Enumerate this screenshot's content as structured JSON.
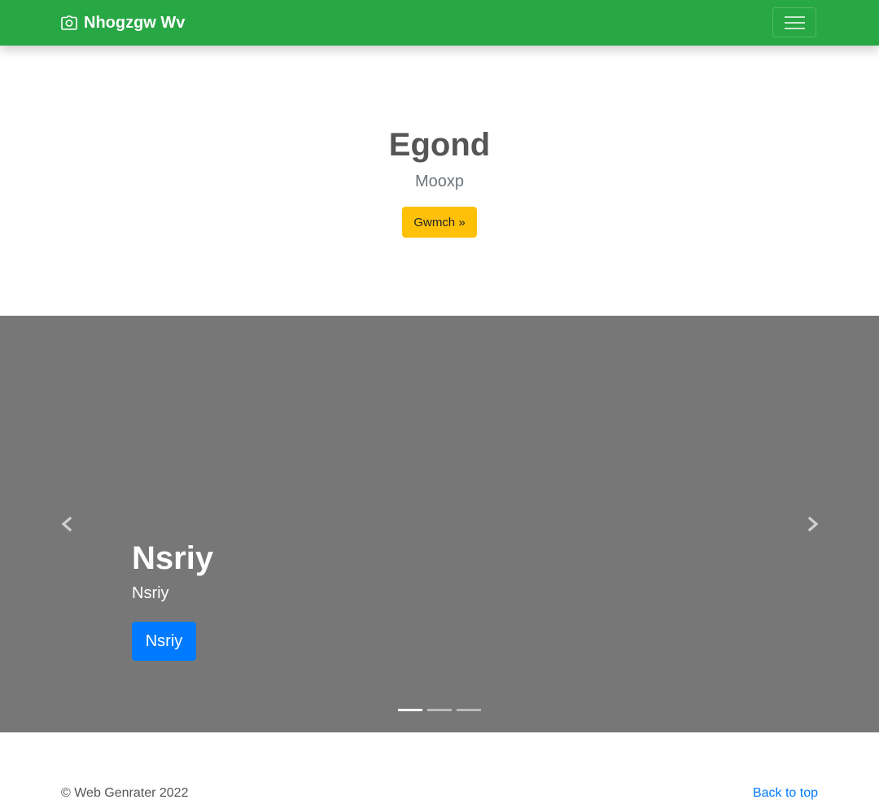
{
  "navbar": {
    "brand_icon": "camera-icon",
    "brand": "Nhogzgw Wv",
    "toggler_icon": "hamburger-menu-icon",
    "color": "#28a745"
  },
  "hero": {
    "title": "Egond",
    "lead": "Mooxp",
    "button_label": "Gwmch »",
    "button_color": "#ffc107"
  },
  "carousel": {
    "background": "#777777",
    "prev_icon": "chevron-left-icon",
    "next_icon": "chevron-right-icon",
    "active_slide": 1,
    "slide_count": 3,
    "caption": {
      "title": "Nsriy",
      "text": "Nsriy",
      "button_label": "Nsriy",
      "button_color": "#007bff"
    }
  },
  "footer": {
    "copyright": "© Web Genrater 2022",
    "back_to_top": "Back to top"
  }
}
